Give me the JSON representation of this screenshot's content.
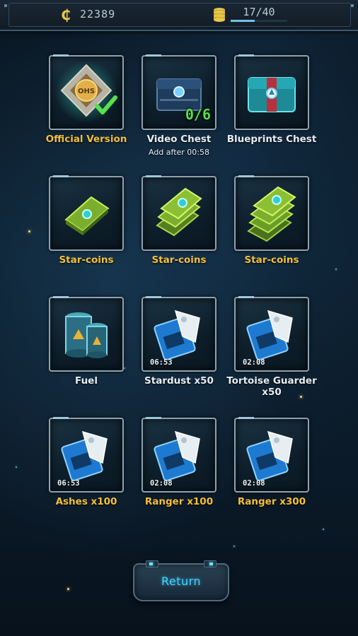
{
  "topbar": {
    "currency_value": "22389",
    "capacity_value": "17/40",
    "capacity_fill": 0.425
  },
  "items": [
    {
      "label": "Official Version",
      "color": "yellow",
      "art": "official-badge",
      "sub": ""
    },
    {
      "label": "Video Chest",
      "color": "white",
      "art": "video-chest",
      "sub": "Add after 00:58",
      "count": "0/6"
    },
    {
      "label": "Blueprints Chest",
      "color": "white",
      "art": "blueprints-chest",
      "sub": ""
    },
    {
      "label": "Star-coins",
      "color": "yellow",
      "art": "coins-1"
    },
    {
      "label": "Star-coins",
      "color": "yellow",
      "art": "coins-2"
    },
    {
      "label": "Star-coins",
      "color": "yellow",
      "art": "coins-3"
    },
    {
      "label": "Fuel",
      "color": "white",
      "art": "fuel"
    },
    {
      "label": "Stardust x50",
      "color": "white",
      "art": "blueprint",
      "timer": "06:53"
    },
    {
      "label": "Tortoise Guarder x50",
      "color": "white",
      "art": "blueprint",
      "timer": "02:08"
    },
    {
      "label": "Ashes x100",
      "color": "yellow",
      "art": "blueprint",
      "timer": "06:53"
    },
    {
      "label": "Ranger x100",
      "color": "yellow",
      "art": "blueprint",
      "timer": "02:08"
    },
    {
      "label": "Ranger x300",
      "color": "yellow",
      "art": "blueprint",
      "timer": "02:08"
    }
  ],
  "return_label": "Return",
  "official_badge_text": "OHS"
}
